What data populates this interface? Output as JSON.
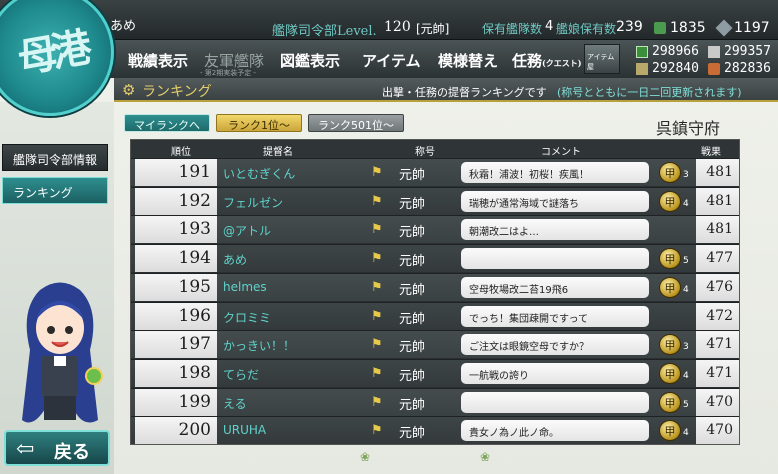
{
  "header": {
    "admiral_name": "あめ",
    "hq_level_label": "艦隊司令部Level.",
    "hq_level": "120",
    "rank_title": "[元帥]",
    "ship_count_label": "保有艦隊数",
    "ship_count": "4",
    "equip_count_label": "艦娘保有数",
    "equip_count": "239",
    "buckets": "1835",
    "screws": "1197"
  },
  "emblem_text": "母港",
  "menu": {
    "items": [
      "戦績表示",
      "友軍艦隊",
      "図鑑表示",
      "アイテム",
      "模様替え",
      "任務"
    ],
    "mission_sub": "(クエスト)",
    "friend_note": "- 第2期実装予定 -",
    "item_shop_label": "アイテム屋"
  },
  "resources": {
    "fuel": "298966",
    "ammo": "292840",
    "steel": "299357",
    "bauxite": "282836"
  },
  "section": {
    "title": "ランキング",
    "description": "出撃・任務の提督ランキングです",
    "note": "(称号とともに一日二回更新されます)"
  },
  "sidebar": {
    "items": [
      "艦隊司令部情報",
      "ランキング"
    ],
    "back_label": "戻る"
  },
  "tabs": [
    "マイランクへ",
    "ランク1位～",
    "ランク501位～"
  ],
  "base_name": "呉鎮守府",
  "table": {
    "headers": [
      "順位",
      "提督名",
      "称号",
      "コメント",
      "戦果"
    ],
    "rows": [
      {
        "rank": "191",
        "name": "いとむぎくん",
        "title": "元帥",
        "comment": "秋霜！浦波！初桜！疾風！",
        "medals": "3",
        "score": "481"
      },
      {
        "rank": "192",
        "name": "フェルゼン",
        "title": "元帥",
        "comment": "瑞穂が通常海域で謎落ち",
        "medals": "4",
        "score": "481"
      },
      {
        "rank": "193",
        "name": "@アトル",
        "title": "元帥",
        "comment": "朝潮改二はよ…",
        "medals": "",
        "score": "481"
      },
      {
        "rank": "194",
        "name": "あめ",
        "title": "元帥",
        "comment": "",
        "medals": "5",
        "score": "477"
      },
      {
        "rank": "195",
        "name": "helmes",
        "title": "元帥",
        "comment": "空母牧場改二苔19飛6",
        "medals": "4",
        "score": "476"
      },
      {
        "rank": "196",
        "name": "クロミミ",
        "title": "元帥",
        "comment": "でっち！集団疎開ですって",
        "medals": "",
        "score": "472"
      },
      {
        "rank": "197",
        "name": "かっきい！！",
        "title": "元帥",
        "comment": "ご注文は眼鏡空母ですか？",
        "medals": "3",
        "score": "471"
      },
      {
        "rank": "198",
        "name": "てらだ",
        "title": "元帥",
        "comment": "一航戦の誇り",
        "medals": "4",
        "score": "471"
      },
      {
        "rank": "199",
        "name": "える",
        "title": "元帥",
        "comment": "",
        "medals": "5",
        "score": "470"
      },
      {
        "rank": "200",
        "name": "URUHA",
        "title": "元帥",
        "comment": "貴女ノ為ノ此ノ命。",
        "medals": "4",
        "score": "470"
      }
    ]
  },
  "icons": {
    "gear": "gear-icon",
    "flag": "flag-icon",
    "medal": "medal-icon",
    "back": "back-arrow-icon"
  },
  "colors": {
    "accent_teal": "#2f8f8f",
    "gold": "#e5ce6a",
    "name_teal": "#5fd3cb"
  }
}
